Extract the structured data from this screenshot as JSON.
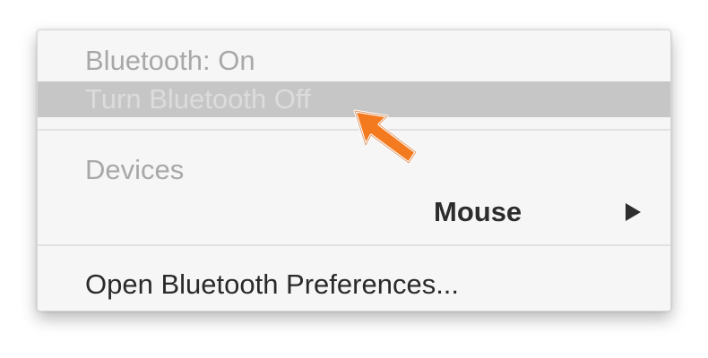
{
  "menu": {
    "status_label": "Bluetooth: On",
    "toggle_label": "Turn Bluetooth Off",
    "devices_header": "Devices",
    "device_name": "Mouse",
    "preferences_label": "Open Bluetooth Preferences..."
  },
  "icons": {
    "submenu": "chevron-right-icon",
    "pointer": "orange-arrow-pointer-icon"
  },
  "colors": {
    "highlight": "#c6c6c6",
    "arrow": "#f47a1f",
    "menu_bg": "#f6f6f6"
  }
}
